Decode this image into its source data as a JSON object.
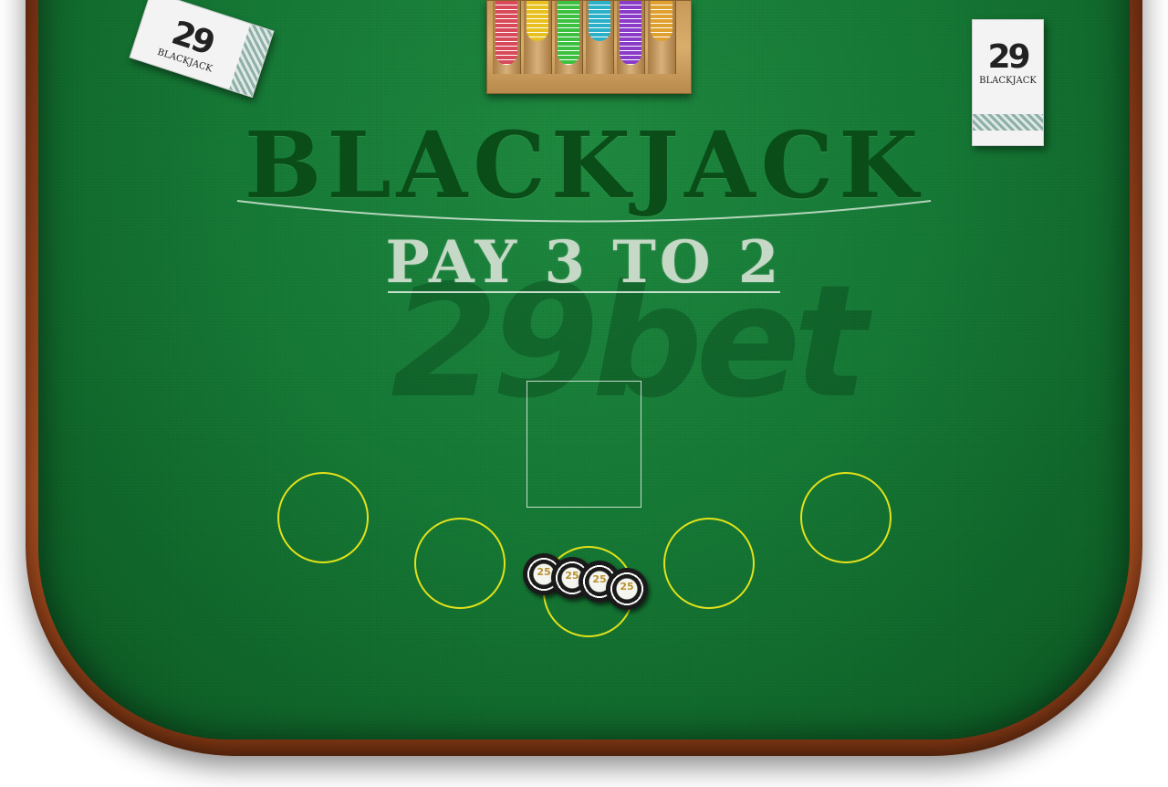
{
  "table": {
    "title": "BLACKJACK",
    "payout": "PAY 3 TO 2",
    "watermark": "29bet"
  },
  "left_deck": {
    "number": "29",
    "label": "BLACKJACK"
  },
  "right_deck": {
    "number": "29",
    "label": "BLACKJACK"
  },
  "chip_tray": {
    "stack_colors": [
      "#d84a5a",
      "#e8c020",
      "#3cc040",
      "#2ab0c8",
      "#8a3cc8",
      "#e0a030"
    ]
  },
  "bet_chips": {
    "denomination": "25",
    "count": 4
  },
  "colors": {
    "felt": "#167a36",
    "spot_ring": "#e3e21a",
    "wood": "#8b3d18"
  }
}
